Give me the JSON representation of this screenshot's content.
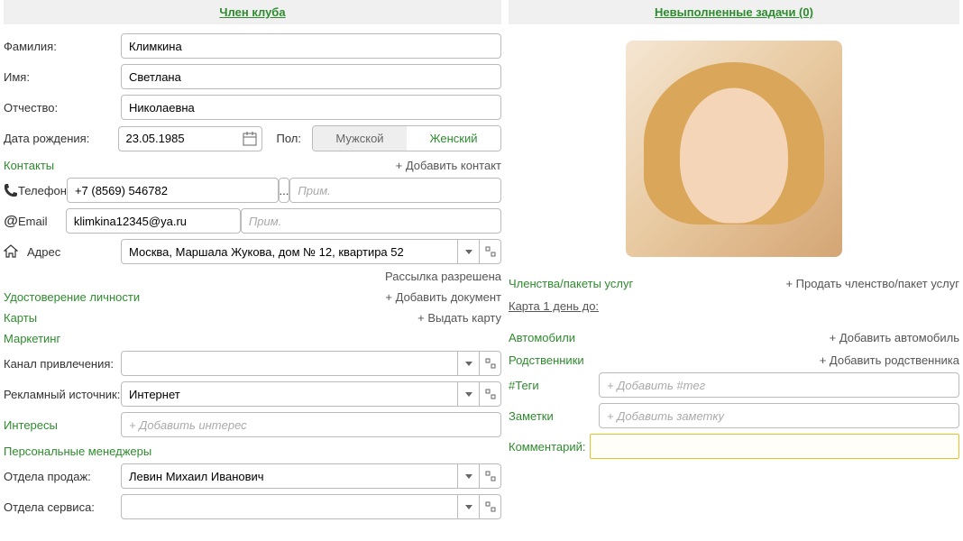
{
  "left": {
    "header": "Член клуба",
    "lastname_label": "Фамилия:",
    "lastname": "Климкина",
    "firstname_label": "Имя:",
    "firstname": "Светлана",
    "middlename_label": "Отчество:",
    "middlename": "Николаевна",
    "dob_label": "Дата рождения:",
    "dob": "23.05.1985",
    "gender_label": "Пол:",
    "gender_male": "Мужской",
    "gender_female": "Женский",
    "contacts_title": "Контакты",
    "add_contact": "+ Добавить контакт",
    "phone_label": "Телефон",
    "phone": "+7 (8569) 546782",
    "phone_more": "...",
    "phone_note_ph": "Прим.",
    "email_label": "Email",
    "email": "klimkina12345@ya.ru",
    "email_note_ph": "Прим.",
    "address_label": "Адрес",
    "address": "Москва, Маршала Жукова, дом № 12, квартира 52",
    "mailing_allowed": "Рассылка разрешена",
    "id_title": "Удостоверение личности",
    "add_document": "+ Добавить документ",
    "cards_title": "Карты",
    "issue_card": "+ Выдать карту",
    "marketing_title": "Маркетинг",
    "channel_label": "Канал привлечения:",
    "channel": "",
    "adsource_label": "Рекламный источник:",
    "adsource": "Интернет",
    "interests_title": "Интересы",
    "add_interest_ph": "+ Добавить интерес",
    "managers_title": "Персональные менеджеры",
    "sales_label": "Отдела продаж:",
    "sales_manager": "Левин Михаил Иванович",
    "service_label": "Отдела сервиса:",
    "service_manager": ""
  },
  "right": {
    "header": "Невыполненные задачи (0)",
    "memberships_title": "Членства/пакеты услуг",
    "sell_membership": "+ Продать членство/пакет услуг",
    "card_until": "Карта 1 день до:",
    "cars_title": "Автомобили",
    "add_car": "+ Добавить автомобиль",
    "relatives_title": "Родственники",
    "add_relative": "+ Добавить родственника",
    "tags_title": "#Теги",
    "add_tag_ph": "+ Добавить #тег",
    "notes_title": "Заметки",
    "add_note_ph": "+ Добавить заметку",
    "comment_label": "Комментарий:"
  }
}
